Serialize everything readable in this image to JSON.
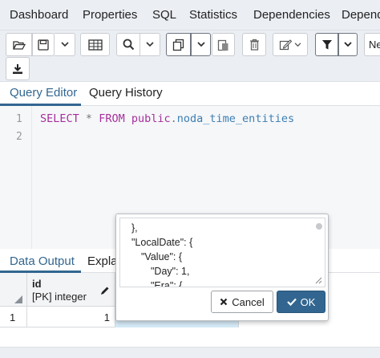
{
  "top_tabs": [
    "Dashboard",
    "Properties",
    "SQL",
    "Statistics",
    "Dependencies",
    "Dependen"
  ],
  "toolbar": {
    "icons": [
      "folder-open-icon",
      "save-icon",
      "chevron-down-icon",
      "grid-icon",
      "search-icon",
      "chevron-down-icon",
      "copy-icon",
      "chevron-down-icon",
      "paste-icon",
      "delete-icon",
      "edit-icon",
      "chevron-down-icon",
      "filter-icon",
      "chevron-down-icon",
      "download-icon"
    ],
    "partial_button_label": "Ne"
  },
  "query_tabs": {
    "editor": "Query Editor",
    "history": "Query History"
  },
  "editor": {
    "line_numbers": [
      "1",
      "2"
    ],
    "sql": {
      "select": "SELECT",
      "star": "*",
      "from": "FROM",
      "schema": "public",
      "dot": ".",
      "table": "noda_time_entities"
    }
  },
  "result_tabs": {
    "data_output": "Data Output",
    "explain": "Expla"
  },
  "grid": {
    "column_name": "id",
    "column_type": "[PK] integer",
    "row_number": "1",
    "row_value": "1"
  },
  "popup": {
    "json_lines": [
      "},",
      "\"LocalDate\": {",
      "\"Value\": {",
      "\"Day\": 1,",
      "\"Era\": {"
    ],
    "cancel_label": "Cancel",
    "ok_label": "OK"
  },
  "colors": {
    "accent": "#326690",
    "keyword": "#a6309b",
    "identifier": "#3c7fb3",
    "toolbar_bg": "#ebeef3"
  }
}
